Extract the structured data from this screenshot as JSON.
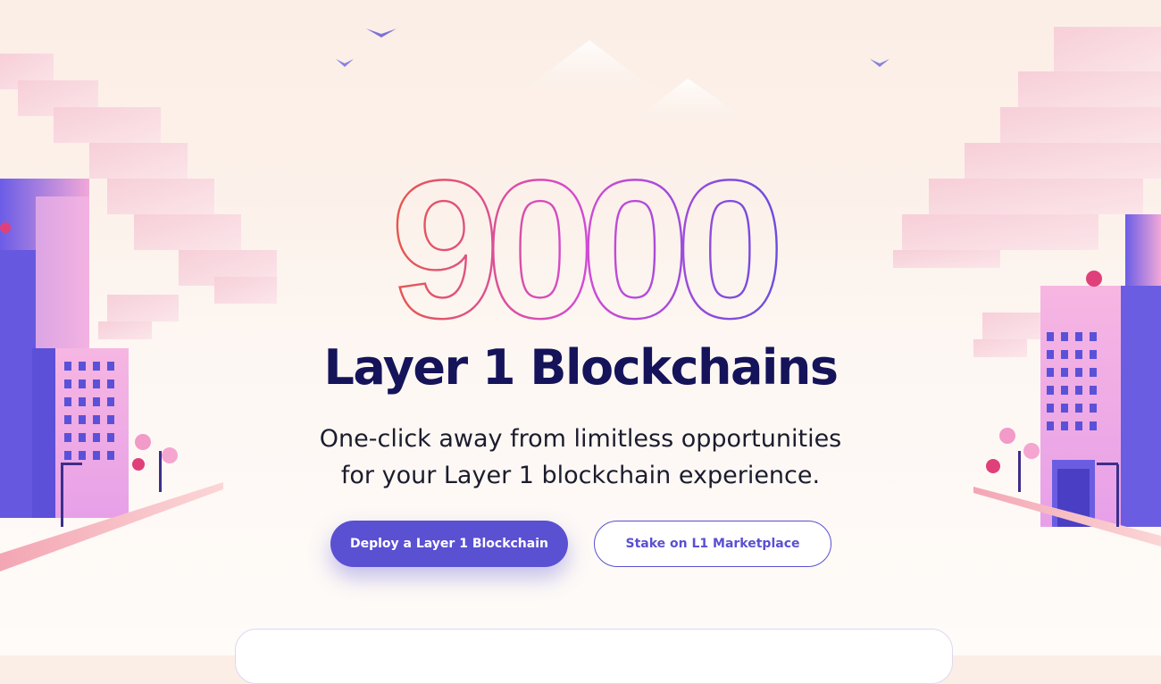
{
  "hero": {
    "number": "9000",
    "headline": "Layer 1 Blockchains",
    "subtitle_line1": "One-click away from limitless opportunities",
    "subtitle_line2": "for your Layer 1 blockchain experience."
  },
  "actions": {
    "primary_label": "Deploy a Layer 1 Blockchain",
    "secondary_label": "Stake on L1 Marketplace"
  },
  "colors": {
    "brand": "#5a50d2",
    "headline": "#15135a",
    "gradient_start": "#e8564a",
    "gradient_mid": "#d24ad6",
    "gradient_end": "#6a4de0"
  }
}
